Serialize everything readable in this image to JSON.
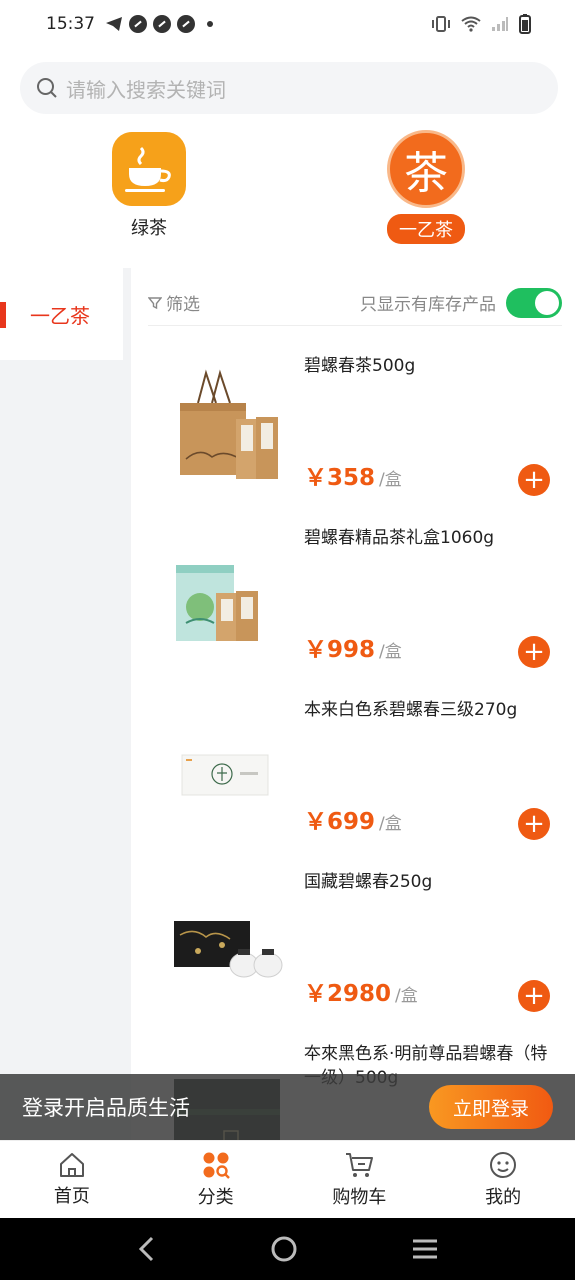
{
  "status_bar": {
    "time": "15:37"
  },
  "search": {
    "placeholder": "请输入搜索关键词"
  },
  "brands": [
    {
      "label": "绿茶",
      "icon": "tea-cup-icon",
      "selected": false
    },
    {
      "label": "一乙茶",
      "icon": "tea-character-icon",
      "logo_text": "茶",
      "selected": true
    }
  ],
  "sidebar": {
    "items": [
      {
        "label": "一乙茶",
        "selected": true
      }
    ]
  },
  "filter": {
    "label": "筛选",
    "stock_only_label": "只显示有库存产品",
    "stock_only_enabled": true
  },
  "products": [
    {
      "name": "碧螺春茶500g",
      "price": "￥358",
      "unit": "/盒"
    },
    {
      "name": "碧螺春精品茶礼盒1060g",
      "price": "￥998",
      "unit": "/盒"
    },
    {
      "name": "本来白色系碧螺春三级270g",
      "price": "￥699",
      "unit": "/盒"
    },
    {
      "name": "国藏碧螺春250g",
      "price": "￥2980",
      "unit": "/盒"
    },
    {
      "name": "夲來黑色系·明前尊品碧螺春（特一级）500g"
    }
  ],
  "login_banner": {
    "text": "登录开启品质生活",
    "button": "立即登录"
  },
  "tab_bar": {
    "items": [
      {
        "label": "首页",
        "icon": "home-icon"
      },
      {
        "label": "分类",
        "icon": "category-icon",
        "selected": true
      },
      {
        "label": "购物车",
        "icon": "cart-icon"
      },
      {
        "label": "我的",
        "icon": "profile-icon"
      }
    ]
  },
  "colors": {
    "accent": "#ef5a12",
    "sidebar_active": "#e8361c",
    "toggle_on": "#1fbf5f"
  }
}
